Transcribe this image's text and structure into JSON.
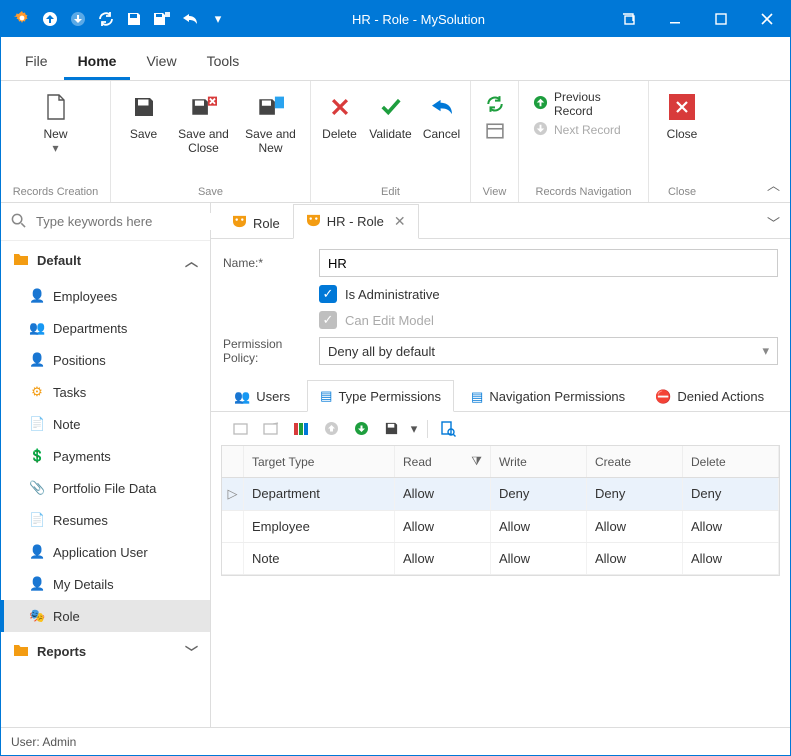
{
  "title": "HR - Role - MySolution",
  "menu": {
    "file": "File",
    "home": "Home",
    "view": "View",
    "tools": "Tools"
  },
  "ribbon": {
    "new": "New",
    "save": "Save",
    "saveClose": "Save and Close",
    "saveNew": "Save and New",
    "delete": "Delete",
    "validate": "Validate",
    "cancel": "Cancel",
    "prev": "Previous Record",
    "next": "Next Record",
    "close": "Close",
    "groups": {
      "records": "Records Creation",
      "save": "Save",
      "edit": "Edit",
      "view": "View",
      "nav": "Records Navigation",
      "close": "Close"
    }
  },
  "search": {
    "placeholder": "Type keywords here"
  },
  "nav": {
    "default": "Default",
    "reports": "Reports",
    "items": [
      "Employees",
      "Departments",
      "Positions",
      "Tasks",
      "Note",
      "Payments",
      "Portfolio File Data",
      "Resumes",
      "Application User",
      "My Details",
      "Role"
    ]
  },
  "tabs": {
    "role": "Role",
    "hrRole": "HR - Role"
  },
  "form": {
    "nameLabel": "Name:*",
    "nameValue": "HR",
    "isAdmin": "Is Administrative",
    "canEdit": "Can Edit Model",
    "policyLabel": "Permission Policy:",
    "policyValue": "Deny all by default"
  },
  "subTabs": {
    "users": "Users",
    "type": "Type Permissions",
    "nav": "Navigation Permissions",
    "denied": "Denied Actions"
  },
  "grid": {
    "cols": {
      "target": "Target Type",
      "read": "Read",
      "write": "Write",
      "create": "Create",
      "delete": "Delete"
    },
    "rows": [
      {
        "target": "Department",
        "read": "Allow",
        "write": "Deny",
        "create": "Deny",
        "delete": "Deny"
      },
      {
        "target": "Employee",
        "read": "Allow",
        "write": "Allow",
        "create": "Allow",
        "delete": "Allow"
      },
      {
        "target": "Note",
        "read": "Allow",
        "write": "Allow",
        "create": "Allow",
        "delete": "Allow"
      }
    ]
  },
  "status": {
    "user": "User: Admin"
  }
}
